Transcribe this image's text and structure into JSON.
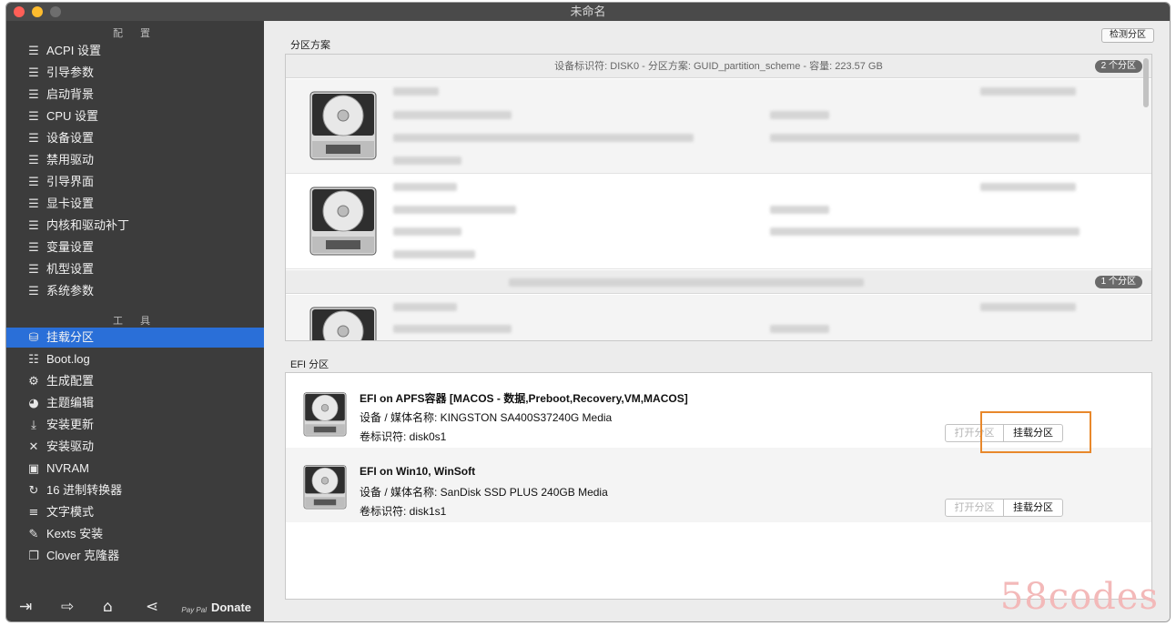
{
  "window": {
    "title": "未命名"
  },
  "sidebar": {
    "config_label": "配 置",
    "tools_label": "工 具",
    "config_items": [
      {
        "label": "ACPI 设置",
        "icon": "list-icon"
      },
      {
        "label": "引导参数",
        "icon": "list-icon"
      },
      {
        "label": "启动背景",
        "icon": "list-icon"
      },
      {
        "label": "CPU 设置",
        "icon": "list-icon"
      },
      {
        "label": "设备设置",
        "icon": "list-icon"
      },
      {
        "label": "禁用驱动",
        "icon": "list-icon"
      },
      {
        "label": "引导界面",
        "icon": "list-icon"
      },
      {
        "label": "显卡设置",
        "icon": "list-icon"
      },
      {
        "label": "内核和驱动补丁",
        "icon": "list-icon"
      },
      {
        "label": "变量设置",
        "icon": "list-icon"
      },
      {
        "label": "机型设置",
        "icon": "list-icon"
      },
      {
        "label": "系统参数",
        "icon": "list-icon"
      }
    ],
    "tool_items": [
      {
        "label": "挂载分区",
        "icon": "disk-icon",
        "selected": true
      },
      {
        "label": "Boot.log",
        "icon": "log-icon"
      },
      {
        "label": "生成配置",
        "icon": "gears-icon"
      },
      {
        "label": "主题编辑",
        "icon": "palette-icon"
      },
      {
        "label": "安装更新",
        "icon": "download-icon"
      },
      {
        "label": "安装驱动",
        "icon": "tools-icon"
      },
      {
        "label": "NVRAM",
        "icon": "chip-icon"
      },
      {
        "label": "16 进制转换器",
        "icon": "refresh-icon"
      },
      {
        "label": "文字模式",
        "icon": "text-icon"
      },
      {
        "label": "Kexts 安装",
        "icon": "kext-icon"
      },
      {
        "label": "Clover 克隆器",
        "icon": "clone-icon"
      }
    ],
    "paypal": "Pay Pal",
    "donate": "Donate"
  },
  "main": {
    "partition_scheme_label": "分区方案",
    "detect_button": "检测分区",
    "disk0_header": "设备标识符: DISK0 - 分区方案: GUID_partition_scheme - 容量: 223.57 GB",
    "disk0_count": "2 个分区",
    "disk1_count": "1 个分区",
    "efi_label": "EFI 分区",
    "efi_entries": [
      {
        "title": "EFI on APFS容器 [MACOS - 数据,Preboot,Recovery,VM,MACOS]",
        "device": "设备 / 媒体名称: KINGSTON SA400S37240G Media",
        "volume": "卷标识符: disk0s1",
        "open_label": "打开分区",
        "mount_label": "挂载分区"
      },
      {
        "title": "EFI on Win10, WinSoft",
        "device": "设备 / 媒体名称: SanDisk SSD PLUS 240GB Media",
        "volume": "卷标识符: disk1s1",
        "open_label": "打开分区",
        "mount_label": "挂载分区"
      }
    ]
  },
  "watermark": "58codes",
  "colors": {
    "accent": "#2a6fd8",
    "highlight": "#e8882b",
    "sidebar": "#3c3c3c"
  }
}
